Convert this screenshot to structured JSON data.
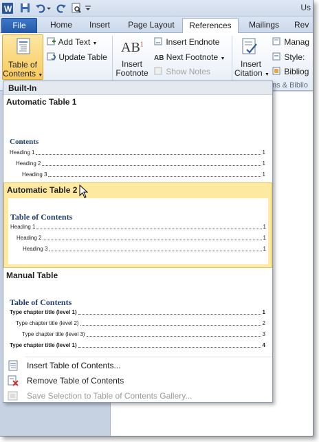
{
  "window": {
    "title_fragment": "Us"
  },
  "tabs": [
    {
      "label": "File"
    },
    {
      "label": "Home"
    },
    {
      "label": "Insert"
    },
    {
      "label": "Page Layout"
    },
    {
      "label": "References"
    },
    {
      "label": "Mailings"
    },
    {
      "label": "Rev"
    }
  ],
  "ribbon": {
    "toc_button": {
      "line1": "Table of",
      "line2": "Contents"
    },
    "add_text": "Add Text",
    "update_table": "Update Table",
    "insert_footnote": {
      "line1": "Insert",
      "line2": "Footnote"
    },
    "insert_endnote": "Insert Endnote",
    "next_footnote": "Next Footnote",
    "show_notes": "Show Notes",
    "insert_citation": {
      "line1": "Insert",
      "line2": "Citation"
    },
    "manage_sources": "Manag",
    "style": "Style:",
    "bibliography": "Bibliog",
    "group_label_fragment": "ns & Biblio"
  },
  "menu": {
    "section_header": "Built-In",
    "items": [
      {
        "title": "Automatic Table 1",
        "heading": "Contents",
        "lines": [
          {
            "label": "Heading 1",
            "page": "1"
          },
          {
            "label": "Heading 2",
            "page": "1"
          },
          {
            "label": "Heading 3",
            "page": "1"
          }
        ]
      },
      {
        "title": "Automatic Table 2",
        "heading": "Table of Contents",
        "lines": [
          {
            "label": "Heading 1",
            "page": "1"
          },
          {
            "label": "Heading 2",
            "page": "1"
          },
          {
            "label": "Heading 3",
            "page": "1"
          }
        ]
      },
      {
        "title": "Manual Table",
        "heading": "Table of Contents",
        "lines": [
          {
            "label": "Type chapter title (level 1)",
            "page": "1"
          },
          {
            "label": "Type chapter title (level 2)",
            "page": "2"
          },
          {
            "label": "Type chapter title (level 3)",
            "page": "3"
          },
          {
            "label": "Type chapter title (level 1)",
            "page": "4"
          }
        ]
      }
    ],
    "commands": [
      {
        "label": "Insert Table of Contents..."
      },
      {
        "label": "Remove Table of Contents"
      },
      {
        "label": "Save Selection to Table of Contents Gallery..."
      }
    ]
  },
  "colors": {
    "accent": "#2559a8",
    "hover_fill": "#fdeaa0",
    "hover_border": "#e8c45c",
    "toc_heading": "#1f3f74"
  }
}
